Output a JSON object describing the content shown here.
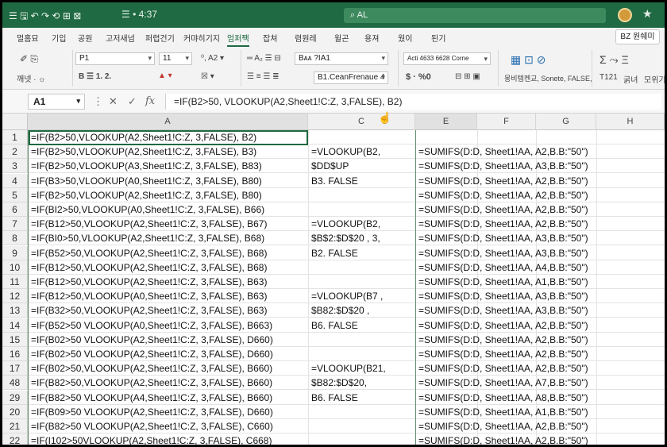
{
  "titlebar": {
    "qat_text": "☰ 🖫 ↶ ↷  ⟲  ⊞  ⊠",
    "center_text": "☰ • 4:37",
    "search_text": "AL"
  },
  "tabs": [
    "멀홈묘",
    "기입",
    "공원",
    "고저새넘",
    "퍼렵건기",
    "커먀히기지",
    "엄퍼짹",
    "잡쳐",
    "렴원레",
    "윌곤",
    "용져",
    "웠이",
    "된기"
  ],
  "active_tab": 6,
  "share_label": "BZ 원쉐미",
  "ribbon": {
    "font_name": "P1",
    "font_size": "11",
    "style_box": "Bᴀᴀ ?IA1",
    "merge_box": "B1.CeanFrenaue 4",
    "number_format": "Acti 4633 6628 Corne",
    "currency": "$ · %0",
    "cond_label": "몽비템켄교, Sonete, FALSE,",
    "sum_label": "T121",
    "sort_label": "굵녀",
    "find_label": "모위기",
    "paste_label": "깨넷 · ☼"
  },
  "formula_bar": {
    "name_box": "A1",
    "formula": "=IF(B2>50, VLOOKUP(A2,Sheet1!C:Z, 3,FALSE), B2)"
  },
  "columns": [
    "A",
    "C",
    "E",
    "F",
    "G",
    "H"
  ],
  "rows": [
    {
      "n": "1",
      "a": "=IF(B2>50,VLOOKUP(A2,Sheet1!C:Z, 3,FALSE), B2)",
      "c": "",
      "e": ""
    },
    {
      "n": "2",
      "a": "=IF(B2>50,VLOOKUP(A2,Sheet1!C:Z, 3,FALSE), B3)",
      "c": "=VLOOKUP(B2,",
      "e": "=SUMIFS(D:D, Sheet1!AA, A2,B.B:\"50\")"
    },
    {
      "n": "3",
      "a": "=IF(B2>50,VLOOKUP(A3,Sheet1!C:Z, 3,FALSE), B83)",
      "c": "$DD$UP",
      "e": "=SUMIFS(D:D, Sheet1!AA, A3,B.B:\"50\")"
    },
    {
      "n": "4",
      "a": "=IF(B3>50,VLOOKUP(A0,Sheet1!C:Z, 3,FALSE), B80)",
      "c": "B3. FALSE",
      "e": "=SUMIFS(D:D, Sheet1!AA, A2,B.B:\"50\")"
    },
    {
      "n": "5",
      "a": "=IF(B2>50,VLOOKUP(A2,Sheet1!C:Z, 3,FALSE), B80)",
      "c": "",
      "e": "=SUMIFS(D:D, Sheet1!AA, A2,B.B:\"50\")"
    },
    {
      "n": "6",
      "a": "=IF(BI2>50,VLOOKUP(A0,Sheet1!C:Z, 3,FALSE), B66)",
      "c": "",
      "e": "=SUMIFS(D:D, Sheet1!AA, A2,B.B:\"50\")"
    },
    {
      "n": "7",
      "a": "=IF(B12>50,VLOOKUP(A2,Sheet1!C:Z, 3,FALSE), B67)",
      "c": "=VLOOKUP(B2,",
      "e": "=SUMIFS(D:D, Sheet1!AA, A2,B.B:\"50\")"
    },
    {
      "n": "8",
      "a": "=IF(BI0>50,VLOOKUP(A2,Sheet1!C:Z, 3,FALSE), B68)",
      "c": "$B$2:$D$20 , 3,",
      "e": "=SUMIFS(D:D, Sheet1!AA, A3,B.B:\"50\")"
    },
    {
      "n": "9",
      "a": "=IF(B52>50,VLOOKUP(A2,Sheet1!C:Z, 3,FALSE), B68)",
      "c": "B2. FALSE",
      "e": "=SUMIFS(D:D, Sheet1!AA, A3,B.B:\"50\")"
    },
    {
      "n": "10",
      "a": "=IF(B12>50,VLOOKUP(A2,Sheet1!C:Z, 3,FALSE), B68)",
      "c": "",
      "e": "=SUMIFS(D:D, Sheet1!AA, A4,B.B:\"50\")"
    },
    {
      "n": "11",
      "a": "=IF(B12>50,VLOOKUP(A2,Sheet1!C:Z, 3,FALSE), B63)",
      "c": "",
      "e": "=SUMIFS(D:D, Sheet1!AA, A1,B.B:\"50\")"
    },
    {
      "n": "12",
      "a": "=IF(B12>50,VLOOKUP(A0,Sheet1!C:Z, 3,FALSE), B63)",
      "c": "=VLOOKUP(B7 ,",
      "e": "=SUMIFS(D:D, Sheet1!AA, A3,B.B:\"50\")"
    },
    {
      "n": "13",
      "a": "=IF(B32>50,VLOOKUP(A2,Sheet1!C:Z, 3,FALSE), B63)",
      "c": "$B82:$D$20 ,",
      "e": "=SUMIFS(D:D, Sheet1!AA, A3,B.B:\"50\")"
    },
    {
      "n": "14",
      "a": "=IF(B52>50 VLOOKUP(A0,Sheet1!C:Z, 3,FALSE), B663)",
      "c": "B6. FALSE",
      "e": "=SUMIFS(D:D, Sheet1!AA, A2,B.B:\"50\")"
    },
    {
      "n": "15",
      "a": "=IF(B02>50 VLOOKUP(A2,Sheet1!C:Z, 3,FALSE), D660)",
      "c": "",
      "e": "=SUMIFS(D:D, Sheet1!AA, A2,B.B:\"50\")"
    },
    {
      "n": "16",
      "a": "=IF(B02>50 VLOOKUP(A2,Sheet1!C:Z, 3,FALSE), D660)",
      "c": "",
      "e": "=SUMIFS(D:D, Sheet1!AA, A2,B.B:\"50\")"
    },
    {
      "n": "17",
      "a": "=IF(B02>50,VLOOKUP(A2,Sheet1!C:Z, 3,FALSE), B660)",
      "c": "=VLOOKUP(B21,",
      "e": "=SUMIFS(D:D, Sheet1!AA, A2,B.B:\"50\")"
    },
    {
      "n": "48",
      "a": "=IF(B82>50,VLOOKUP(A2,Sheet1!C:Z, 3,FALSE), B660)",
      "c": "$B82:$D$20,",
      "e": "=SUMIFS(D:D, Sheet1!AA, A7,B.B:\"50\")"
    },
    {
      "n": "29",
      "a": "=IF(B82>50 VLOOKUP(A4,Sheet1!C:Z, 3,FALSE), B660)",
      "c": "B6. FALSE",
      "e": "=SUMIFS(D:D, Sheet1!AA, A8,B.B:\"50\")"
    },
    {
      "n": "20",
      "a": "=IF(B09>50 VLOOKUP(A2,Sheet1!C:Z, 3,FALSE), D660)",
      "c": "",
      "e": "=SUMIFS(D:D, Sheet1!AA, A1,B.B:\"50\")"
    },
    {
      "n": "21",
      "a": "=IF(B82>50 VLOOKUP(A2,Sheet1!C:Z, 3,FALSE), C660)",
      "c": "",
      "e": "=SUMIFS(D:D, Sheet1!AA, A2,B.B:\"50\")"
    },
    {
      "n": "22",
      "a": "=IF(I102>50VLOOKUP(A2,Sheet1!C:Z, 3,FALSE), C668)",
      "c": "",
      "e": "=SUMIFS(D:D, Sheet1!AA, A2,B.B:\"50\")"
    }
  ]
}
